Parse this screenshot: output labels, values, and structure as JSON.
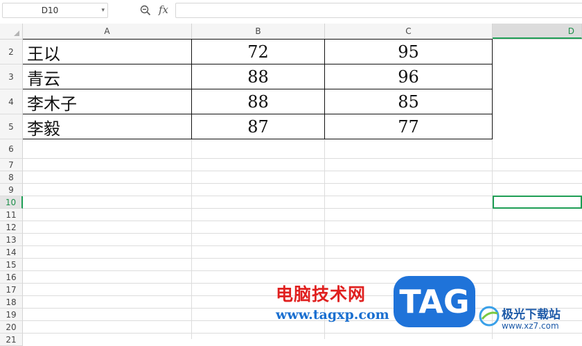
{
  "formula_bar": {
    "cell_reference": "D10",
    "fx_label": "fx",
    "formula_value": ""
  },
  "columns": [
    "A",
    "B",
    "C",
    "D"
  ],
  "active_column": "D",
  "rows": [
    "2",
    "3",
    "4",
    "5",
    "6",
    "7",
    "8",
    "9",
    "10",
    "11",
    "12",
    "13",
    "14",
    "15",
    "16",
    "17",
    "18",
    "19",
    "20",
    "21"
  ],
  "active_row": "10",
  "table": [
    {
      "name": "王以",
      "b": "72",
      "c": "95"
    },
    {
      "name": "青云",
      "b": "88",
      "c": "96"
    },
    {
      "name": "李木子",
      "b": "88",
      "c": "85"
    },
    {
      "name": "李毅",
      "b": "87",
      "c": "77"
    }
  ],
  "watermark": {
    "title": "电脑技术网",
    "url": "www.tagxp.com",
    "tag": "TAG",
    "site_name": "极光下载站",
    "site_url": "www.xz7.com"
  },
  "colors": {
    "selection": "#1e9e55",
    "watermark_red": "#e0201f",
    "watermark_blue": "#1f73d9"
  }
}
